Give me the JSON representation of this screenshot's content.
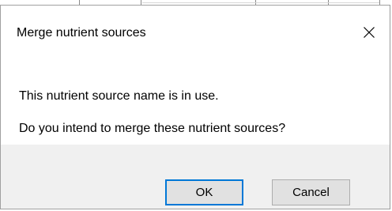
{
  "dialog": {
    "title": "Merge nutrient sources",
    "close_icon": "close-icon",
    "messages": {
      "line1": "This nutrient source name is in use.",
      "line2": "Do you intend to merge these nutrient sources?"
    },
    "buttons": {
      "ok_label": "OK",
      "cancel_label": "Cancel"
    }
  },
  "colors": {
    "footer_background": "#f0f0f0",
    "button_background": "#e1e1e1",
    "default_button_border": "#0078d7",
    "button_border": "#adadad"
  }
}
